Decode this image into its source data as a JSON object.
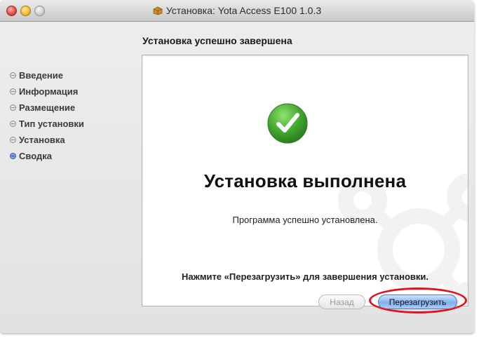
{
  "window": {
    "title": "Установка: Yota Access E100 1.0.3"
  },
  "heading": "Установка успешно завершена",
  "steps": [
    {
      "label": "Введение",
      "active": false
    },
    {
      "label": "Информация",
      "active": false
    },
    {
      "label": "Размещение",
      "active": false
    },
    {
      "label": "Тип установки",
      "active": false
    },
    {
      "label": "Установка",
      "active": false
    },
    {
      "label": "Сводка",
      "active": true
    }
  ],
  "panel": {
    "status_icon": "checkmark-icon",
    "title": "Установка выполнена",
    "message": "Программа успешно установлена.",
    "hint": "Нажмите «Перезагрузить» для завершения установки."
  },
  "buttons": {
    "back": "Назад",
    "restart": "Перезагрузить"
  },
  "colors": {
    "check_green": "#43a52f",
    "restart_blue": "#7fb0ee",
    "highlight_red": "#e0141c"
  }
}
